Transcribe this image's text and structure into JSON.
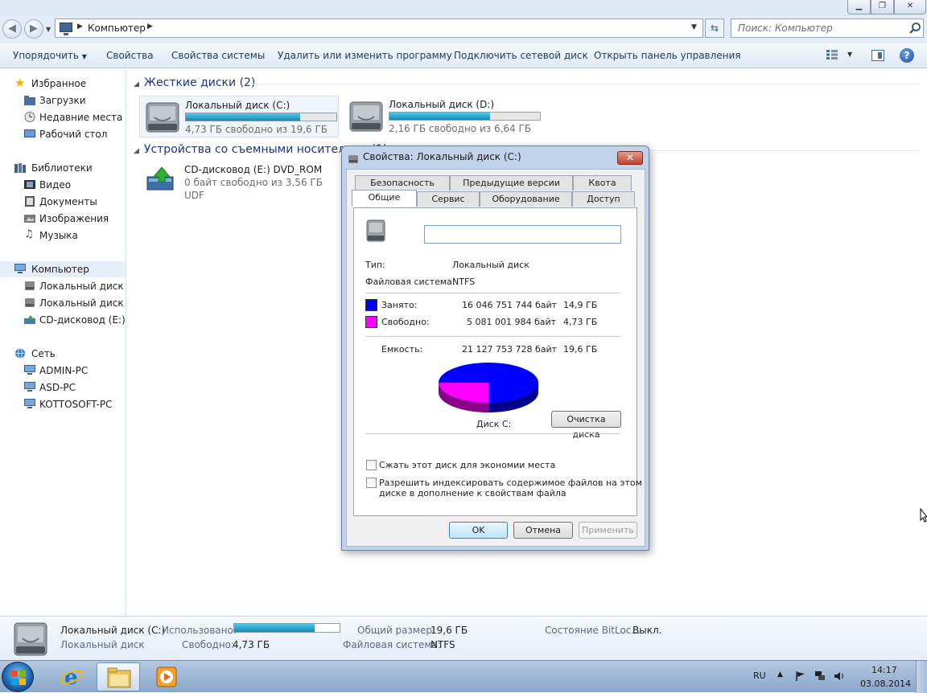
{
  "window": {
    "controls": {
      "minimize": "▁",
      "maximize": "❐",
      "close": "✕"
    }
  },
  "address": {
    "back_icon": "back-arrow-icon",
    "forward_icon": "forward-arrow-icon",
    "crumb": "Компьютер",
    "search_placeholder": "Поиск: Компьютер"
  },
  "toolbar": {
    "organize": "Упорядочить",
    "properties": "Свойства",
    "system_properties": "Свойства системы",
    "uninstall": "Удалить или изменить программу",
    "map_drive": "Подключить сетевой диск",
    "open_control_panel": "Открыть панель управления",
    "help": "?"
  },
  "nav": {
    "favorites": "Избранное",
    "downloads": "Загрузки",
    "recent": "Недавние места",
    "desktop": "Рабочий стол",
    "libraries": "Библиотеки",
    "video": "Видео",
    "documents": "Документы",
    "pictures": "Изображения",
    "music": "Музыка",
    "computer": "Компьютер",
    "drive_c": "Локальный диск (C:)",
    "drive_d": "Локальный диск (D:)",
    "drive_e": "CD-дисковод (E:) DVD_ROM",
    "network": "Сеть",
    "pc1": "ADMIN-PC",
    "pc2": "ASD-PC",
    "pc3": "KOTTOSOFT-PC"
  },
  "content": {
    "hdd_group": "Жесткие диски (2)",
    "removable_group": "Устройства со съемными носителями (1)",
    "drives": [
      {
        "name": "Локальный диск (C:)",
        "free": "4,73 ГБ свободно из 19,6 ГБ",
        "used_fraction": 0.76
      },
      {
        "name": "Локальный диск (D:)",
        "free": "2,16 ГБ свободно из 6,64 ГБ",
        "used_fraction": 0.67
      }
    ],
    "cd": {
      "name": "CD-дисковод (E:) DVD_ROM",
      "free": "0 байт свободно из 3,56 ГБ",
      "fs": "UDF"
    }
  },
  "dialog": {
    "title": "Свойства: Локальный диск (C:)",
    "close": "✕",
    "tabs_back": [
      "Безопасность",
      "Предыдущие версии",
      "Квота"
    ],
    "tabs_front": [
      "Общие",
      "Сервис",
      "Оборудование",
      "Доступ"
    ],
    "active_tab": "Общие",
    "label_value": "",
    "type_label": "Тип:",
    "type_value": "Локальный диск",
    "fs_label": "Файловая система:",
    "fs_value": "NTFS",
    "used_label": "Занято:",
    "used_bytes": "16 046 751 744 байт",
    "used_gb": "14,9 ГБ",
    "free_label": "Свободно:",
    "free_bytes": "5 081 001 984 байт",
    "free_gb": "4,73 ГБ",
    "capacity_label": "Емкость:",
    "capacity_bytes": "21 127 753 728 байт",
    "capacity_gb": "19,6 ГБ",
    "disk_label": "Диск C:",
    "cleanup_button": "Очистка диска",
    "compress_label": "Сжать этот диск для экономии места",
    "index_label_1": "Разрешить индексировать содержимое файлов на этом",
    "index_label_2": "диске в дополнение к свойствам файла",
    "ok": "OK",
    "cancel": "Отмена",
    "apply": "Применить",
    "used_color": "#0000ff",
    "free_color": "#ff00ff"
  },
  "details": {
    "name": "Локальный диск (C:)",
    "type": "Локальный диск",
    "used_label": "Использовано:",
    "used_fraction": 0.76,
    "free_label": "Свободно:",
    "free_value": "4,73 ГБ",
    "total_label": "Общий размер:",
    "total_value": "19,6 ГБ",
    "fs_label": "Файловая система:",
    "fs_value": "NTFS",
    "bitlocker_label": "Состояние BitLoc...",
    "bitlocker_value": "Выкл."
  },
  "taskbar": {
    "lang": "RU",
    "time": "14:17",
    "date": "03.08.2014"
  }
}
